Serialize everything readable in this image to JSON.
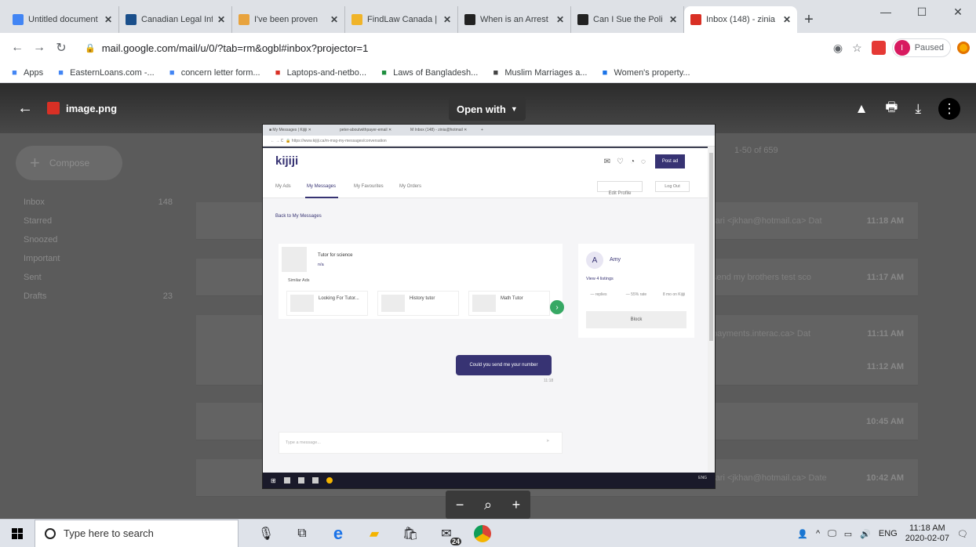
{
  "browser": {
    "tabs": [
      {
        "title": "Untitled document",
        "icon": "docs-icon",
        "color": "#4285f4"
      },
      {
        "title": "Canadian Legal Inf",
        "icon": "canlii-icon",
        "color": "#1a4f8b"
      },
      {
        "title": "I've been proven",
        "icon": "emoji-icon",
        "color": "#e8a33d"
      },
      {
        "title": "FindLaw Canada |",
        "icon": "findlaw-icon",
        "color": "#f0b429"
      },
      {
        "title": "When is an Arrest",
        "icon": "notion-icon",
        "color": "#222222"
      },
      {
        "title": "Can I Sue the Poli",
        "icon": "notion-icon",
        "color": "#222222"
      },
      {
        "title": "Inbox (148) - zinia",
        "icon": "gmail-icon",
        "color": "#d93025",
        "active": true
      }
    ],
    "url": "mail.google.com/mail/u/0/?tab=rm&ogbl#inbox?projector=1",
    "profile_status": "Paused",
    "profile_initial": "I"
  },
  "bookmarks": [
    {
      "label": "Apps",
      "icon": "apps-grid-icon",
      "color": "#4285f4"
    },
    {
      "label": "EasternLoans.com -...",
      "icon": "google-icon",
      "color": "#4285f4"
    },
    {
      "label": "concern letter form...",
      "icon": "google-icon",
      "color": "#4285f4"
    },
    {
      "label": "Laptops-and-netbo...",
      "icon": "bookmark-red-icon",
      "color": "#d93025"
    },
    {
      "label": "Laws of Bangladesh...",
      "icon": "bookmark-flag-icon",
      "color": "#1e8e3e"
    },
    {
      "label": "Muslim Marriages a...",
      "icon": "globe-icon",
      "color": "#444444"
    },
    {
      "label": "Women's property...",
      "icon": "globe-icon",
      "color": "#1a73e8"
    }
  ],
  "viewer": {
    "filename": "image.png",
    "open_with": "Open with"
  },
  "gmail_bg": {
    "compose": "Compose",
    "nav": [
      {
        "label": "Inbox",
        "count": "148"
      },
      {
        "label": "Starred",
        "count": ""
      },
      {
        "label": "Snoozed",
        "count": ""
      },
      {
        "label": "Important",
        "count": ""
      },
      {
        "label": "Sent",
        "count": ""
      },
      {
        "label": "Drafts",
        "count": "23"
      }
    ],
    "rows": [
      {
        "sender": "",
        "snippet": "rari <jkhan@hotmail.ca> Dat",
        "time": "11:18 AM"
      },
      {
        "sender": "",
        "snippet": "send my brothers test sco",
        "time": "11:17 AM"
      },
      {
        "sender": "",
        "snippet": "payments.interac.ca> Dat",
        "time": "11:11 AM"
      },
      {
        "sender": "",
        "snippet": "",
        "time": "11:12 AM"
      },
      {
        "sender": "",
        "snippet": "",
        "time": "10:45 AM"
      },
      {
        "sender": "",
        "snippet": "rari <jkhan@hotmail.ca> Date",
        "time": "10:42 AM"
      }
    ],
    "pager": "1-50 of 659"
  },
  "kijiji": {
    "logo": "kijiji",
    "post": "Post ad",
    "nav": [
      "My Ads",
      "My Messages",
      "My Favourites",
      "My Orders"
    ],
    "edit_profile": "Edit Profile",
    "logout": "Log Out",
    "back_link": "Back to My Messages",
    "ad_title": "Tutor for science",
    "ad_sub": "n/a",
    "similar_title": "Similar Ads",
    "similar": [
      "Looking For Tutor...",
      "History tutor",
      "Math Tutor"
    ],
    "message": "Could you send me your number",
    "message_time": "11:18",
    "compose_placeholder": "Type a message...",
    "profile_initial": "A",
    "profile_name": "Amy",
    "view_listings": "View 4 listings",
    "stats": [
      "— replies",
      "— 55% rate",
      "8 mo on Kijiji"
    ],
    "block": "Block"
  },
  "taskbar": {
    "search_placeholder": "Type here to search",
    "lang": "ENG",
    "time": "11:18 AM",
    "date": "2020-02-07",
    "badge": "24"
  }
}
